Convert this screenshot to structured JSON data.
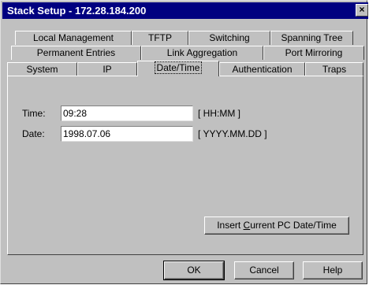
{
  "window": {
    "title": "Stack Setup - 172.28.184.200",
    "close_glyph": "×"
  },
  "tabs": {
    "row1": [
      "Local Management",
      "TFTP",
      "Switching",
      "Spanning Tree"
    ],
    "row2": [
      "Permanent Entries",
      "Link Aggregation",
      "Port Mirroring"
    ],
    "row3": [
      "System",
      "IP",
      "Date/Time",
      "Authentication",
      "Traps"
    ],
    "active": "Date/Time"
  },
  "form": {
    "time_label": "Time:",
    "time_value": "09:28",
    "time_hint": "[ HH:MM ]",
    "date_label": "Date:",
    "date_value": "1998.07.06",
    "date_hint": "[ YYYY.MM.DD ]"
  },
  "insert_button": {
    "prefix": "Insert ",
    "mnemonic": "C",
    "suffix": "urrent PC Date/Time"
  },
  "buttons": {
    "ok": "OK",
    "cancel": "Cancel",
    "help": "Help"
  }
}
